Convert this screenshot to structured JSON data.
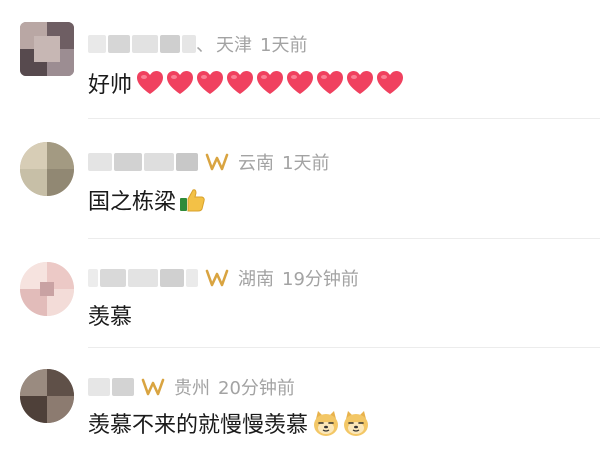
{
  "comments": [
    {
      "separator": "、",
      "location": "天津",
      "time": "1天前",
      "text": "好帅",
      "emoji": "heart-icon",
      "emoji_count": 9,
      "vip": false
    },
    {
      "location": "云南",
      "time": "1天前",
      "text": "国之栋梁",
      "emoji": "thumbs-up-icon",
      "vip": true
    },
    {
      "location": "湖南",
      "time": "19分钟前",
      "text": "羡慕",
      "vip": true
    },
    {
      "location": "贵州",
      "time": "20分钟前",
      "text": "羡慕不来的就慢慢羡慕",
      "emoji": "doge-icon",
      "emoji_count": 2,
      "vip": true
    }
  ],
  "colors": {
    "heart": "#f0415f",
    "vip": "#d9a441",
    "meta_text": "#a3a3a3",
    "body_text": "#1a1a1a",
    "divider": "#ececec"
  }
}
